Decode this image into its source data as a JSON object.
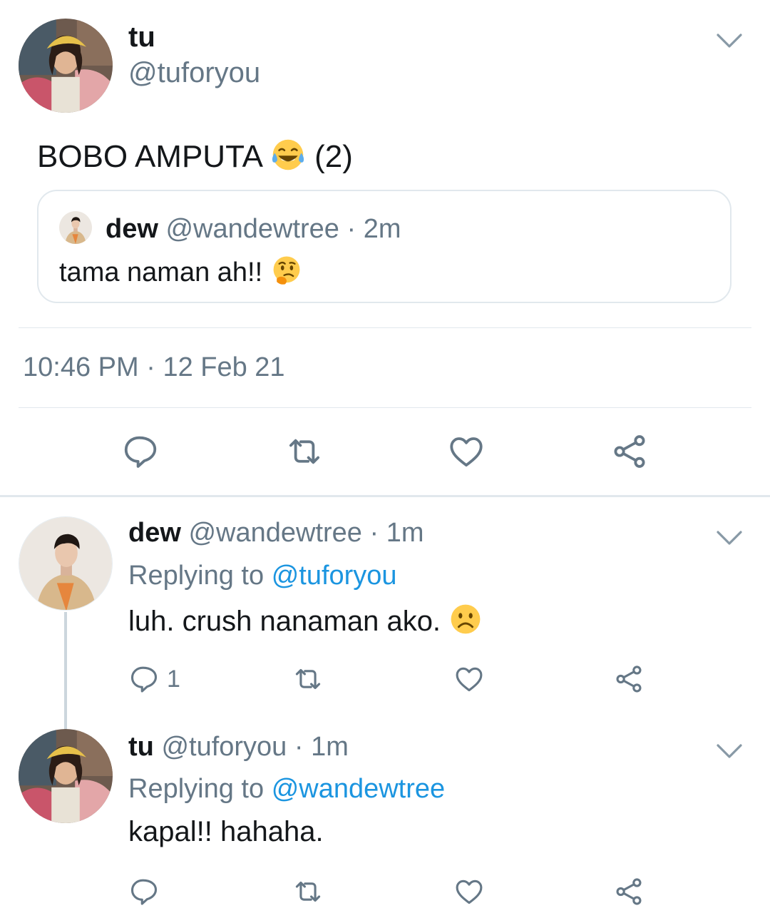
{
  "main_tweet": {
    "display_name": "tu",
    "handle": "@tuforyou",
    "text": "BOBO AMPUTA",
    "text_suffix": "(2)",
    "emoji": "tears-of-joy-emoji",
    "quoted": {
      "display_name": "dew",
      "handle": "@wandewtree",
      "separator": "·",
      "time": "2m",
      "text": "tama naman ah!!",
      "emoji": "thinking-face-emoji"
    },
    "time": "10:46 PM",
    "separator": "·",
    "date": "12 Feb 21"
  },
  "replies": [
    {
      "display_name": "dew",
      "handle": "@wandewtree",
      "separator": "·",
      "time": "1m",
      "replying_prefix": "Replying to",
      "replying_handle": "@tuforyou",
      "text": "luh. crush nanaman ako.",
      "emoji": "frowning-face-emoji",
      "reply_count": "1"
    },
    {
      "display_name": "tu",
      "handle": "@tuforyou",
      "separator": "·",
      "time": "1m",
      "replying_prefix": "Replying to",
      "replying_handle": "@wandewtree",
      "text": "kapal!! hahaha.",
      "reply_count": ""
    }
  ],
  "icons": {
    "reply": "reply-icon",
    "retweet": "retweet-icon",
    "like": "heart-icon",
    "share": "share-icon",
    "menu": "chevron-down-icon"
  },
  "colors": {
    "text": "#14171a",
    "secondary": "#657786",
    "link": "#1b95e0",
    "divider": "#e1e8ed"
  }
}
